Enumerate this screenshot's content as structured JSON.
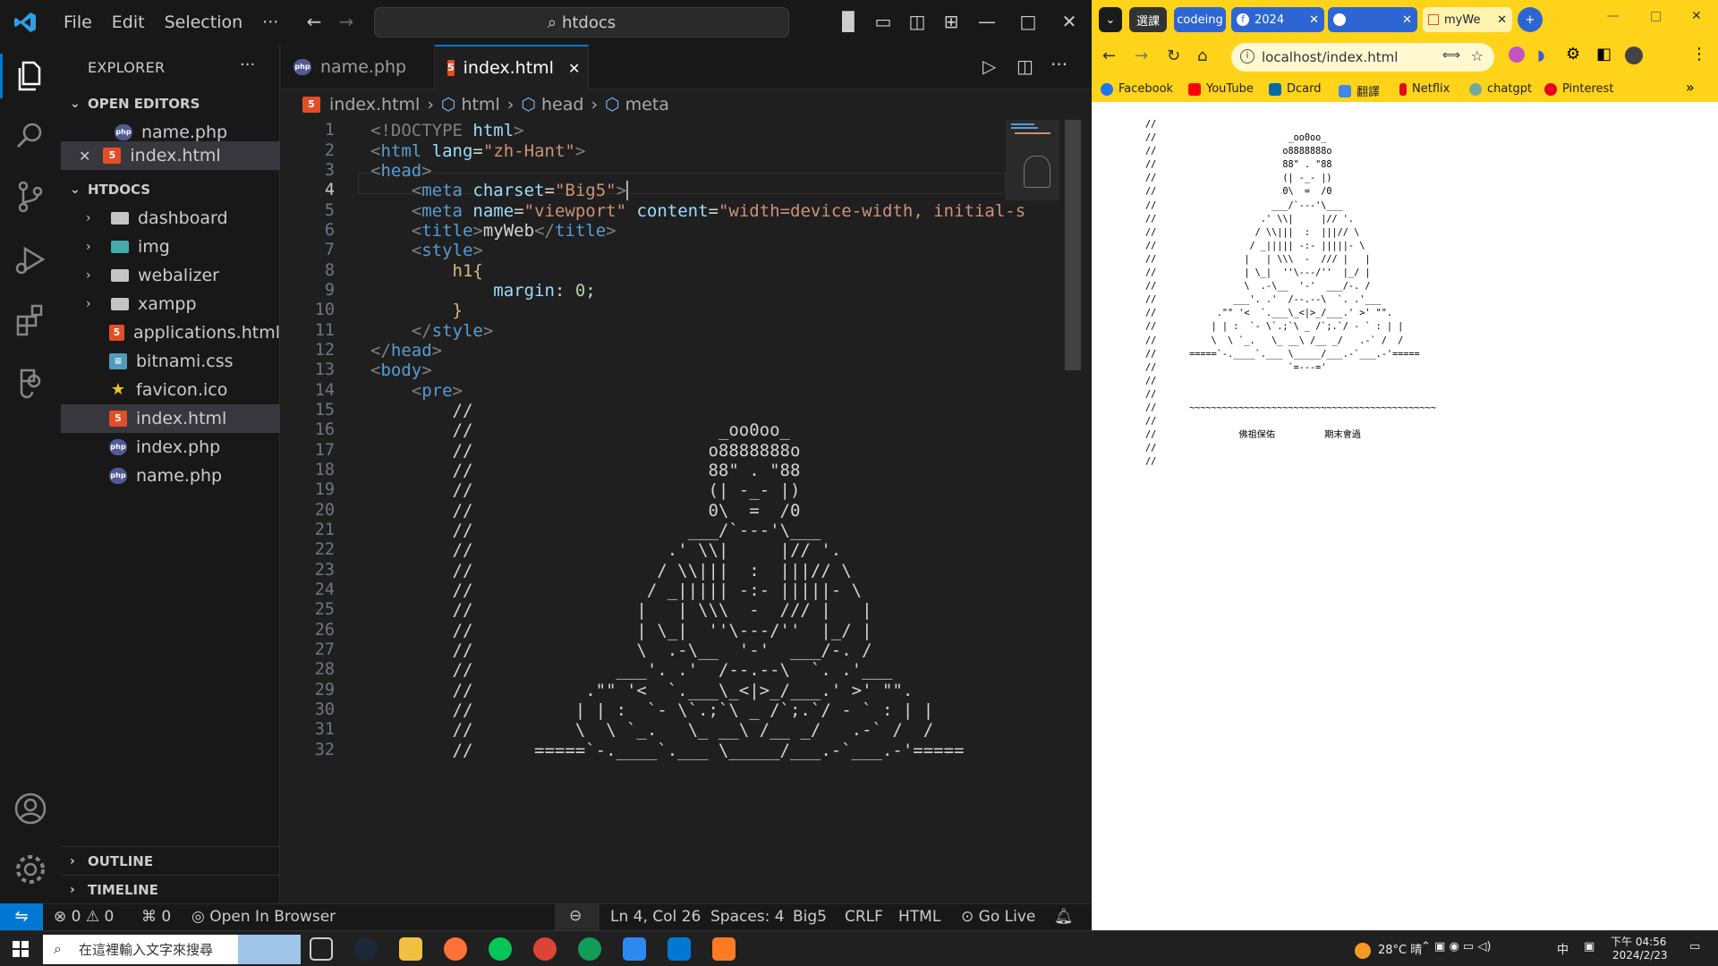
{
  "vscode": {
    "menu": [
      "File",
      "Edit",
      "Selection",
      "···"
    ],
    "command_center": "htdocs",
    "explorer": {
      "title": "EXPLORER",
      "more": "···",
      "open_editors_title": "OPEN EDITORS",
      "open_editors": [
        {
          "name": "name.php",
          "icon": "php-icon",
          "active": false
        },
        {
          "name": "index.html",
          "icon": "html5-icon",
          "active": true
        }
      ],
      "folder_title": "HTDOCS",
      "folders": [
        "dashboard",
        "img",
        "webalizer",
        "xampp"
      ],
      "files": [
        {
          "name": "applications.html",
          "icon": "html5-icon"
        },
        {
          "name": "bitnami.css",
          "icon": "css-icon"
        },
        {
          "name": "favicon.ico",
          "icon": "star-icon"
        },
        {
          "name": "index.html",
          "icon": "html5-icon",
          "selected": true
        },
        {
          "name": "index.php",
          "icon": "php-icon"
        },
        {
          "name": "name.php",
          "icon": "php-icon"
        }
      ],
      "outline_title": "OUTLINE",
      "timeline_title": "TIMELINE"
    },
    "tabs": [
      {
        "name": "name.php",
        "icon": "php-icon",
        "active": false
      },
      {
        "name": "index.html",
        "icon": "html5-icon",
        "active": true
      }
    ],
    "breadcrumb": [
      "index.html",
      "html",
      "head",
      "meta"
    ],
    "current_line": 4,
    "line_numbers": [
      "1",
      "2",
      "3",
      "4",
      "5",
      "6",
      "7",
      "8",
      "9",
      "10",
      "11",
      "12",
      "13",
      "14",
      "15",
      "16",
      "17",
      "18",
      "19",
      "20",
      "21",
      "22",
      "23",
      "24",
      "25",
      "26",
      "27",
      "28",
      "29",
      "30",
      "31",
      "32"
    ],
    "code": {
      "l1_a": "<!DOCTYPE ",
      "l1_b": "html",
      "l1_c": ">",
      "l2_a": "<",
      "l2_b": "html",
      "l2_c": " lang",
      "l2_d": "=",
      "l2_e": "\"zh-Hant\"",
      "l2_f": ">",
      "l3_a": "<",
      "l3_b": "head",
      "l3_c": ">",
      "l4_a": "    <",
      "l4_b": "meta",
      "l4_c": " charset",
      "l4_d": "=",
      "l4_e": "\"Big5\"",
      "l4_f": ">",
      "l5_a": "    <",
      "l5_b": "meta",
      "l5_c": " name",
      "l5_d": "=",
      "l5_e": "\"viewport\"",
      "l5_f": " content",
      "l5_g": "=",
      "l5_h": "\"width=device-width, initial-s",
      "l6_a": "    <",
      "l6_b": "title",
      "l6_c": ">",
      "l6_d": "myWeb",
      "l6_e": "</",
      "l6_f": "title",
      "l6_g": ">",
      "l7_a": "    <",
      "l7_b": "style",
      "l7_c": ">",
      "l8_a": "        ",
      "l8_b": "h1",
      "l8_c": "{",
      "l9_a": "            ",
      "l9_b": "margin",
      "l9_c": ": ",
      "l9_d": "0",
      "l9_e": ";",
      "l10": "        }",
      "l11_a": "    </",
      "l11_b": "style",
      "l11_c": ">",
      "l12_a": "</",
      "l12_b": "head",
      "l12_c": ">",
      "l13_a": "<",
      "l13_b": "body",
      "l13_c": ">",
      "l14_a": "    <",
      "l14_b": "pre",
      "l14_c": ">",
      "art": [
        "        //",
        "        //                        _oo0oo_",
        "        //                       o8888888o",
        "        //                       88\" . \"88",
        "        //                       (| -_- |)",
        "        //                       0\\  =  /0",
        "        //                     ___/`---'\\___",
        "        //                   .' \\\\|     |// '.",
        "        //                  / \\\\|||  :  |||// \\",
        "        //                 / _||||| -:- |||||- \\",
        "        //                |   | \\\\\\  -  /// |   |",
        "        //                | \\_|  ''\\---/''  |_/ |",
        "        //                \\  .-\\__  '-'  ___/-. /",
        "        //              ___'. .'  /--.--\\  `. .'___",
        "        //           .\"\" '<  `.___\\_<|>_/___.' >' \"\".",
        "        //          | | :  `- \\`.;`\\ _ /`;.`/ - ` : | |",
        "        //          \\  \\ `_.   \\_ __\\ /__ _/   .-` /  /",
        "        //      =====`-.____`.___ \\_____/___.-`___.-'====="
      ]
    },
    "status": {
      "errors": "0",
      "warnings": "0",
      "ports": "0",
      "open_in_browser": "Open In Browser",
      "cursor": "Ln 4, Col 26",
      "spaces": "Spaces: 4",
      "encoding": "Big5",
      "eol": "CRLF",
      "language": "HTML",
      "go_live": "Go Live"
    }
  },
  "browser": {
    "tabs": [
      "選課",
      "codeing",
      "2024",
      "",
      "myWe"
    ],
    "url": "localhost/index.html",
    "bookmarks": [
      "Facebook",
      "YouTube",
      "Dcard",
      "翻譯",
      "Netflix",
      "chatgpt",
      "Pinterest"
    ],
    "page_text": "//\n//                        _oo0oo_\n//                       o8888888o\n//                       88\" . \"88\n//                       (| -_- |)\n//                       0\\  =  /0\n//                     ___/`---'\\___\n//                   .' \\\\|     |// '.\n//                  / \\\\|||  :  |||// \\\n//                 / _||||| -:- |||||- \\\n//                |   | \\\\\\  -  /// |   |\n//                | \\_|  ''\\---/''  |_/ |\n//                \\  .-\\__  '-'  ___/-. /\n//              ___'. .'  /--.--\\  `. .'___\n//           .\"\" '<  `.___\\_<|>_/___.' >' \"\".\n//          | | :  `- \\`.;`\\ _ /`;.`/ - ` : | |\n//          \\  \\ `_.   \\_ __\\ /__ _/   .-` /  /\n//      =====`-.____`.___ \\_____/___.-`___.-'=====\n//                        `=---='\n//\n//\n//      ~~~~~~~~~~~~~~~~~~~~~~~~~~~~~~~~~~~~~~~~~~~~~\n//\n//               佛祖保佑         期末會過\n//\n//"
  },
  "taskbar": {
    "search_placeholder": "在這裡輸入文字來搜尋",
    "weather": "28°C 晴",
    "ime": "中",
    "time": "下午 04:56",
    "date": "2024/2/23"
  },
  "colors": {
    "accent": "#0078d4",
    "browser_chrome": "#ffd31a",
    "html_icon": "#e44d26",
    "php_icon": "#4f5b93",
    "folder": "#c5c5c5"
  }
}
